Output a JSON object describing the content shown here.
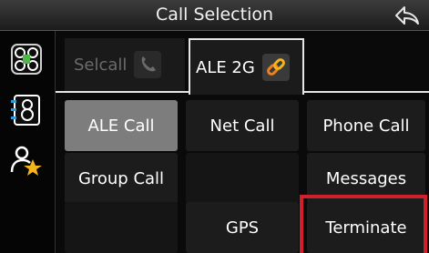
{
  "header": {
    "title": "Call Selection"
  },
  "tabs": [
    {
      "label": "Selcall"
    },
    {
      "label": "ALE 2G"
    }
  ],
  "buttons": {
    "ale_call": "ALE Call",
    "net_call": "Net Call",
    "phone_call": "Phone Call",
    "group_call": "Group Call",
    "messages": "Messages",
    "gps": "GPS",
    "terminate": "Terminate"
  },
  "colors": {
    "highlight": "#d0202c",
    "selected_button": "#7d7d7d",
    "tab_border": "#e6e6e6"
  },
  "icons": {
    "back": "back-arrow-icon",
    "side1": "network-icon",
    "side2": "contact-card-icon",
    "side3": "favorite-contact-icon",
    "selcall": "phone-handset-icon",
    "ale2g": "chain-link-icon"
  }
}
